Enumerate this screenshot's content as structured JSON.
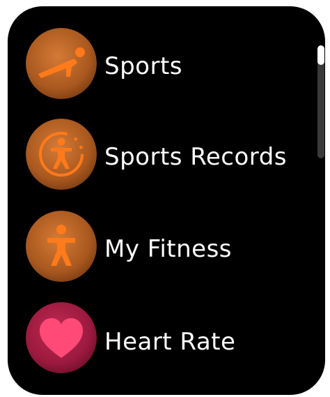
{
  "menu": {
    "items": [
      {
        "label": "Sports",
        "icon": "sports-pushup-icon",
        "color": "#b8662c"
      },
      {
        "label": "Sports Records",
        "icon": "sports-records-icon",
        "color": "#b8662c"
      },
      {
        "label": "My Fitness",
        "icon": "fitness-person-icon",
        "color": "#b8662c"
      },
      {
        "label": "Heart Rate",
        "icon": "heart-icon",
        "color": "#b0204a"
      }
    ]
  },
  "colors": {
    "background": "#000000",
    "accent_orange": "#ff7a1a",
    "heart_pink": "#ff4a78",
    "text": "#ffffff"
  }
}
